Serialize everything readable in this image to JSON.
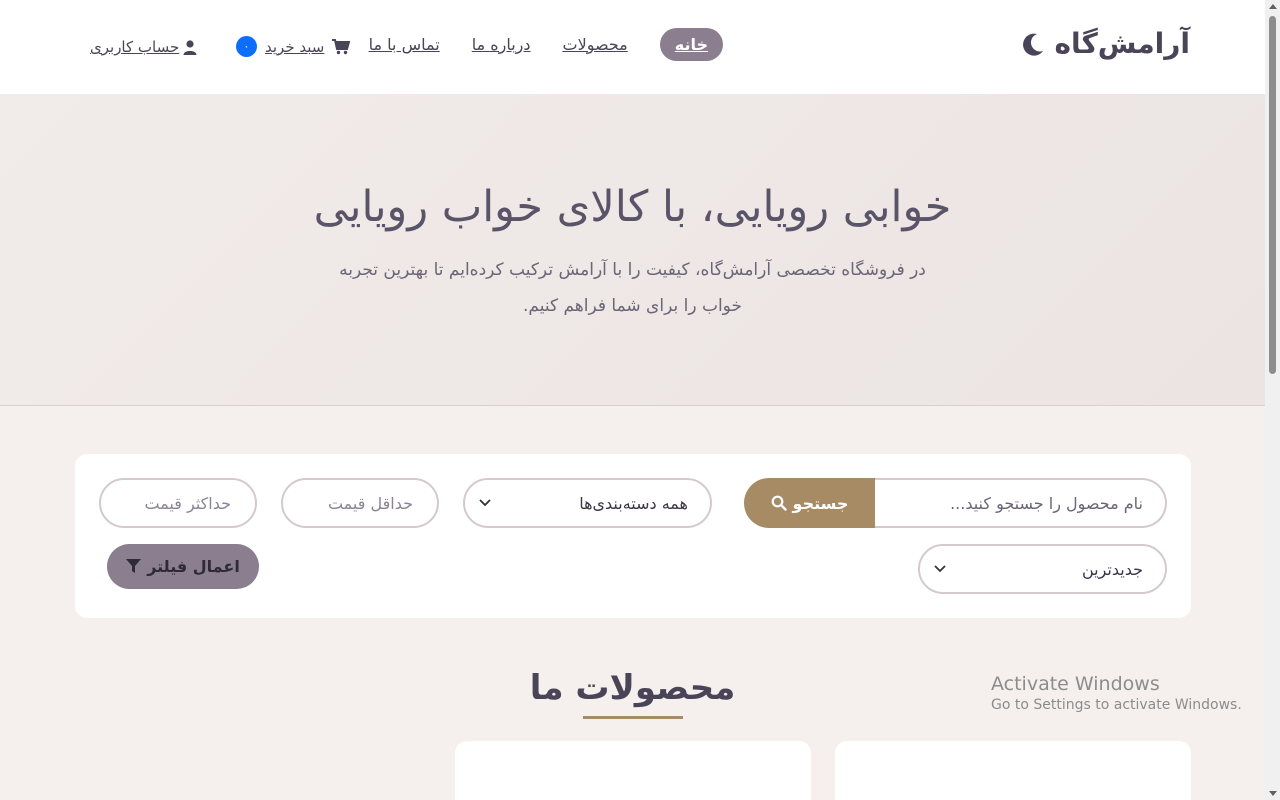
{
  "nav": {
    "brand": "آرامش‌گاه",
    "links": [
      {
        "label": "خانه",
        "active": true
      },
      {
        "label": "محصولات",
        "active": false
      },
      {
        "label": "درباره ما",
        "active": false
      },
      {
        "label": "تماس با ما",
        "active": false
      }
    ],
    "cart_label": "سبد خرید",
    "cart_count": "۰",
    "account_label": "حساب کاربری"
  },
  "hero": {
    "title": "خوابی رویایی، با کالای خواب رویایی",
    "subtitle": "در فروشگاه تخصصی آرامش‌گاه، کیفیت را با آرامش ترکیب کرده‌ایم تا بهترین تجربه خواب را برای شما فراهم کنیم."
  },
  "filters": {
    "search_placeholder": "نام محصول را جستجو کنید...",
    "search_button": "جستجو",
    "category_selected": "همه دسته‌بندی‌ها",
    "min_price_placeholder": "حداقل قیمت",
    "max_price_placeholder": "حداکثر قیمت",
    "sort_selected": "جدیدترین",
    "apply_button": "اعمال فیلتر"
  },
  "products": {
    "title": "محصولات ما"
  },
  "watermark": {
    "title": "Activate Windows",
    "subtitle": "Go to Settings to activate Windows."
  },
  "colors": {
    "accent": "#a68b64",
    "active_nav": "#8a7e8f",
    "badge": "#0d6efd",
    "background": "#f5f0ee"
  }
}
